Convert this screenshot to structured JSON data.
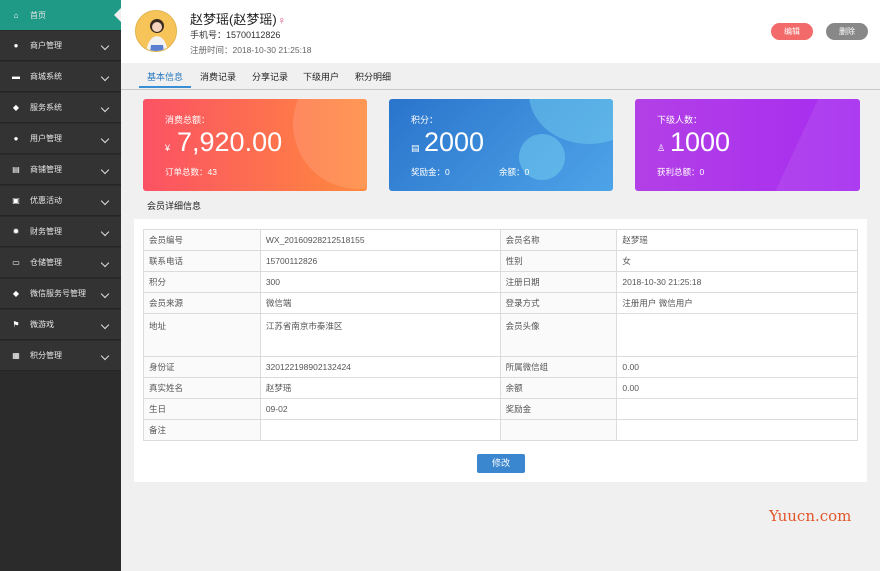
{
  "sidebar": {
    "items": [
      {
        "label": "首页",
        "icon": "home-icon",
        "glyph": "⌂"
      },
      {
        "label": "商户管理",
        "icon": "user-icon",
        "glyph": "●"
      },
      {
        "label": "商城系统",
        "icon": "cart-icon",
        "glyph": "▬"
      },
      {
        "label": "服务系统",
        "icon": "chat-icon",
        "glyph": "◆"
      },
      {
        "label": "用户管理",
        "icon": "users-icon",
        "glyph": "●"
      },
      {
        "label": "商铺管理",
        "icon": "clipboard-icon",
        "glyph": "▤"
      },
      {
        "label": "优惠活动",
        "icon": "gift-icon",
        "glyph": "▣"
      },
      {
        "label": "财务管理",
        "icon": "gear-icon",
        "glyph": "✹"
      },
      {
        "label": "仓储管理",
        "icon": "inbox-icon",
        "glyph": "▭"
      },
      {
        "label": "微信服务号管理",
        "icon": "wechat-icon",
        "glyph": "◆"
      },
      {
        "label": "微游戏",
        "icon": "flag-icon",
        "glyph": "⚑"
      },
      {
        "label": "积分管理",
        "icon": "grid-icon",
        "glyph": "▦"
      }
    ]
  },
  "profile": {
    "name": "赵梦瑶(赵梦瑶)",
    "gender_symbol": "♀",
    "phone": "手机号：15700112826",
    "reg_time": "注册时间：2018-10-30  21:25:18"
  },
  "actions": {
    "edit": "编辑",
    "delete": "删除"
  },
  "tabs": [
    "基本信息",
    "消费记录",
    "分享记录",
    "下级用户",
    "积分明细"
  ],
  "cards": {
    "spend": {
      "label": "消费总额：",
      "currency": "¥",
      "value": "7,920.00",
      "sub": "订单总数：43"
    },
    "points": {
      "label": "积分：",
      "icon": "▤",
      "value": "2000",
      "sub1": "奖励金：0",
      "sub2": "余额：0"
    },
    "downline": {
      "label": "下级人数：",
      "icon": "♙",
      "value": "1000",
      "sub": "获利总额：0"
    }
  },
  "details": {
    "title": "会员详细信息",
    "rows": [
      [
        "会员编号",
        "WX_20160928212518155",
        "会员名称",
        "赵梦瑶"
      ],
      [
        "联系电话",
        "15700112826",
        "性别",
        "女"
      ],
      [
        "积分",
        "300",
        "注册日期",
        "2018-10-30  21:25:18"
      ],
      [
        "会员来源",
        "微信端",
        "登录方式",
        "注册用户  微信用户"
      ],
      [
        "地址",
        "江苏省南京市秦淮区",
        "会员头像",
        ""
      ],
      [
        "身份证",
        "320122198902132424",
        "所属微信组",
        "0.00"
      ],
      [
        "真实姓名",
        "赵梦瑶",
        "余额",
        "0.00"
      ],
      [
        "生日",
        "09-02",
        "奖励金",
        ""
      ],
      [
        "备注",
        "",
        "",
        ""
      ]
    ],
    "modify_button": "修改"
  },
  "watermark": "Yuucn.com",
  "colors": {
    "sidebar_active": "#1e9a86",
    "card_spend": "#fb5c5f",
    "card_points": "#2f82d2",
    "card_downline": "#a435ed",
    "tab_active": "#2a7ac0"
  }
}
